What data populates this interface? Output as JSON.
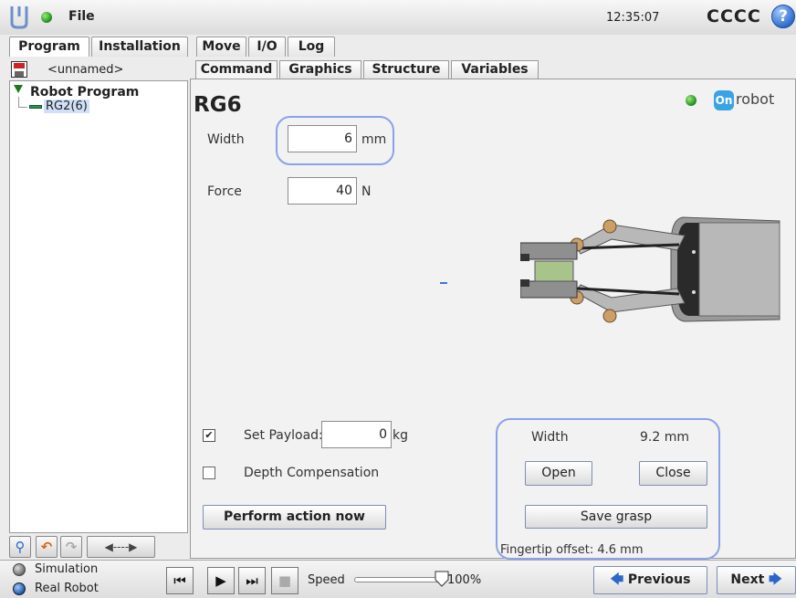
{
  "app": {
    "file_menu": "File",
    "clock": "12:35:07",
    "robot_name": "CCCC",
    "help": "?"
  },
  "tabs": {
    "main": [
      "Program",
      "Installation",
      "Move",
      "I/O",
      "Log"
    ],
    "active_main": "Program",
    "sub": [
      "Command",
      "Graphics",
      "Structure",
      "Variables"
    ],
    "active_sub": "Command"
  },
  "program": {
    "name": "<unnamed>",
    "tree_root": "Robot Program",
    "tree_child": "RG2(6)"
  },
  "tools": {
    "move_label": "◀----▶"
  },
  "node": {
    "title": "RG6",
    "brand": "robot",
    "brand_mark": "On",
    "width_label": "Width",
    "width_value": "6",
    "width_unit": "mm",
    "force_label": "Force",
    "force_value": "40",
    "force_unit": "N",
    "payload_label": "Set Payload:",
    "payload_value": "0",
    "payload_unit": "kg",
    "payload_checked": true,
    "depth_label": "Depth Compensation",
    "depth_checked": false,
    "perform_label": "Perform action now"
  },
  "grip": {
    "width_label": "Width",
    "width_value": "9.2 mm",
    "open_label": "Open",
    "close_label": "Close",
    "save_label": "Save grasp",
    "fingertip_offset": "Fingertip offset: 4.6 mm"
  },
  "footer": {
    "simulation": "Simulation",
    "real_robot": "Real Robot",
    "speed_label": "Speed",
    "speed_value": "100%",
    "speed_fraction": 1.0,
    "previous": "Previous",
    "next": "Next"
  },
  "colors": {
    "highlight": "#8aa3e8",
    "status_green": "#1d8a1d",
    "accent_blue": "#2a67c8"
  }
}
